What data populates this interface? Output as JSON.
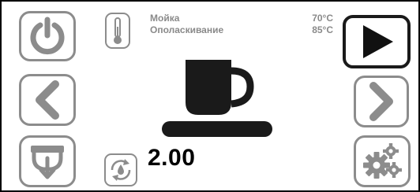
{
  "temperatures": [
    {
      "label": "Мойка",
      "value": "70°C"
    },
    {
      "label": "Ополаскивание",
      "value": "85°C"
    }
  ],
  "counter": {
    "value": "2.00"
  },
  "icons": {
    "power": "power-icon",
    "back": "chevron-left-icon",
    "drain": "drain-icon",
    "start": "play-icon",
    "forward": "chevron-right-icon",
    "settings": "gears-icon",
    "thermometer": "thermometer-icon",
    "counter": "refresh-drop-icon",
    "cup": "cup-icon"
  },
  "colors": {
    "icon_gray": "#8c8c8c",
    "active_dark": "#1a1a1a",
    "text_gray": "#8a8a8a",
    "cup": "#1a1a1a"
  }
}
